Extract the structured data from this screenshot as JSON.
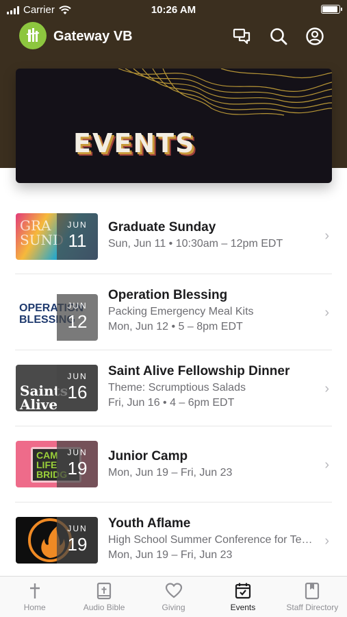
{
  "status_bar": {
    "carrier": "Carrier",
    "time": "10:26 AM"
  },
  "header": {
    "app_name": "Gateway VB"
  },
  "banner": {
    "title": "EVENTS"
  },
  "events": [
    {
      "title": "Graduate Sunday",
      "line1": "Sun, Jun 11 • 10:30am – 12pm EDT",
      "line2": "",
      "month": "JUN",
      "day": "11"
    },
    {
      "title": "Operation Blessing",
      "line1": "Packing Emergency Meal Kits",
      "line2": "Mon, Jun 12 • 5 – 8pm EDT",
      "month": "JUN",
      "day": "12"
    },
    {
      "title": "Saint Alive Fellowship Dinner",
      "line1": "Theme: Scrumptious Salads",
      "line2": "Fri, Jun 16 • 4 – 6pm EDT",
      "month": "JUN",
      "day": "16"
    },
    {
      "title": "Junior Camp",
      "line1": "Mon, Jun 19 – Fri, Jun 23",
      "line2": "",
      "month": "JUN",
      "day": "19"
    },
    {
      "title": "Youth Aflame",
      "line1": "High School Summer Conference for Teens",
      "line2": "Mon, Jun 19 – Fri, Jun 23",
      "month": "JUN",
      "day": "19"
    }
  ],
  "thumbnails": {
    "graduate": "GRA\nSUND",
    "operation": "OPERATION BLESSING",
    "saint": "Saints Alive",
    "junior": "CAM LIFE BRIDG"
  },
  "tabs": [
    {
      "label": "Home",
      "icon": "cross-icon"
    },
    {
      "label": "Audio Bible",
      "icon": "bible-icon"
    },
    {
      "label": "Giving",
      "icon": "heart-icon"
    },
    {
      "label": "Events",
      "icon": "calendar-icon"
    },
    {
      "label": "Staff Directory",
      "icon": "book-icon"
    }
  ],
  "colors": {
    "header_bg": "#3b2f1f",
    "logo_green": "#8dc63f",
    "tab_active": "#1c1c1e",
    "tab_inactive": "#8e8e93"
  }
}
